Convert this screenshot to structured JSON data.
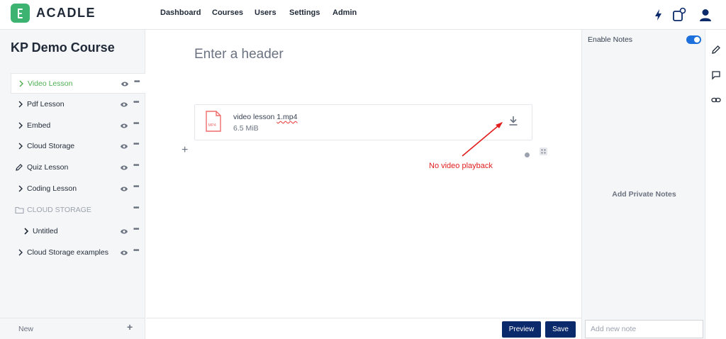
{
  "app": {
    "name": "ACADLE",
    "brand_color": "#3cb371",
    "accent": "#0b2a6b"
  },
  "nav": [
    "Dashboard",
    "Courses",
    "Users",
    "Settings",
    "Admin"
  ],
  "top_icons": [
    "lightning-icon",
    "notification-icon",
    "user-avatar-icon"
  ],
  "sidebar": {
    "course_title": "KP Demo Course",
    "items": [
      {
        "label": "Video Lesson",
        "icon": "chevron-right-icon",
        "active": true
      },
      {
        "label": "Pdf Lesson",
        "icon": "chevron-right-icon"
      },
      {
        "label": "Embed",
        "icon": "chevron-right-icon"
      },
      {
        "label": "Cloud Storage",
        "icon": "chevron-right-icon"
      },
      {
        "label": "Quiz Lesson",
        "icon": "pencil-icon"
      },
      {
        "label": "Coding Lesson",
        "icon": "chevron-right-icon"
      },
      {
        "label": "CLOUD STORAGE",
        "icon": "folder-icon",
        "section": true
      },
      {
        "label": "Untitled",
        "icon": "chevron-right-icon",
        "nested": true
      },
      {
        "label": "Cloud Storage examples",
        "icon": "chevron-right-icon"
      }
    ],
    "more_glyph": "•••",
    "footer": {
      "new_label": "New",
      "add_glyph": "+"
    }
  },
  "editor": {
    "header_placeholder": "Enter a header",
    "file": {
      "name_prefix": "video lesson ",
      "name_suffix": "1.mp4",
      "size": "6.5 MiB",
      "type_badge": "MP4"
    },
    "add_glyph": "+",
    "annotation": "No video playback",
    "preview_label": "Preview",
    "save_label": "Save"
  },
  "notes": {
    "title": "Enable Notes",
    "enabled": true,
    "empty_text": "Add Private Notes",
    "input_placeholder": "Add new note"
  },
  "rail_icons": [
    "edit-icon",
    "comment-icon",
    "link-icon"
  ]
}
